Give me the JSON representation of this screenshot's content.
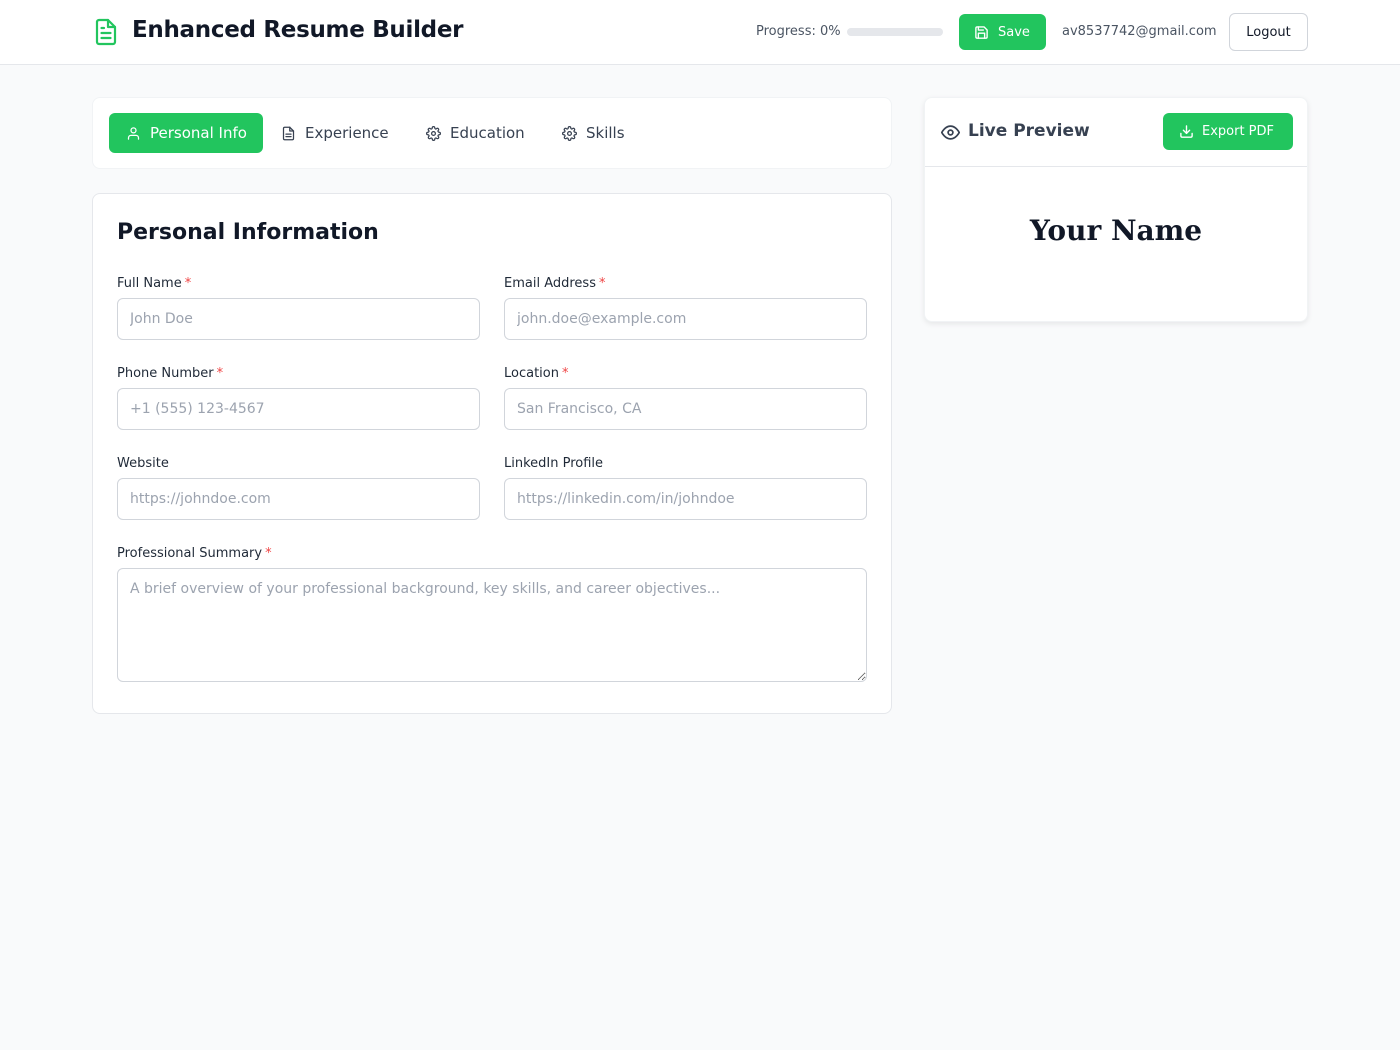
{
  "header": {
    "title": "Enhanced Resume Builder",
    "logo_icon": "file-text-icon",
    "progress_label": "Progress: 0%",
    "progress_value": 0,
    "save_label": "Save",
    "user_email": "av8537742@gmail.com",
    "logout_label": "Logout"
  },
  "tabs": [
    {
      "label": "Personal Info",
      "icon": "user-icon",
      "active": true
    },
    {
      "label": "Experience",
      "icon": "document-icon",
      "active": false
    },
    {
      "label": "Education",
      "icon": "gear-icon",
      "active": false
    },
    {
      "label": "Skills",
      "icon": "gear-icon",
      "active": false
    }
  ],
  "form": {
    "title": "Personal Information",
    "required_mark": "*",
    "full_name": {
      "label": "Full Name",
      "placeholder": "John Doe",
      "value": ""
    },
    "email": {
      "label": "Email Address",
      "placeholder": "john.doe@example.com",
      "value": ""
    },
    "phone": {
      "label": "Phone Number",
      "placeholder": "+1 (555) 123-4567",
      "value": ""
    },
    "location": {
      "label": "Location",
      "placeholder": "San Francisco, CA",
      "value": ""
    },
    "website": {
      "label": "Website",
      "placeholder": "https://johndoe.com",
      "value": ""
    },
    "linkedin": {
      "label": "LinkedIn Profile",
      "placeholder": "https://linkedin.com/in/johndoe",
      "value": ""
    },
    "summary": {
      "label": "Professional Summary",
      "placeholder": "A brief overview of your professional background, key skills, and career objectives...",
      "value": ""
    }
  },
  "preview": {
    "title": "Live Preview",
    "export_label": "Export PDF",
    "name": "Your Name"
  },
  "colors": {
    "accent": "#22c55e",
    "required": "#ef4444",
    "background": "#f9fafb"
  }
}
